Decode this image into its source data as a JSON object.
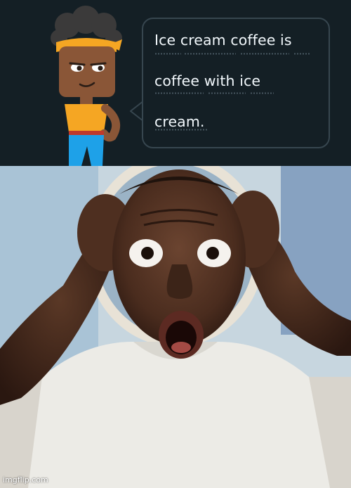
{
  "meme": {
    "top_panel": {
      "background_color": "#141f25",
      "character": "cartoon-woman-with-bandana",
      "speech_bubble": {
        "lines": [
          "Ice cream coffee is",
          "coffee with ice",
          "cream."
        ],
        "text_color": "#f1f7fb",
        "border_color": "#37464f"
      }
    },
    "bottom_panel": {
      "subject": "shocked-man-hands-on-head"
    },
    "watermark": "imgflip.com"
  }
}
